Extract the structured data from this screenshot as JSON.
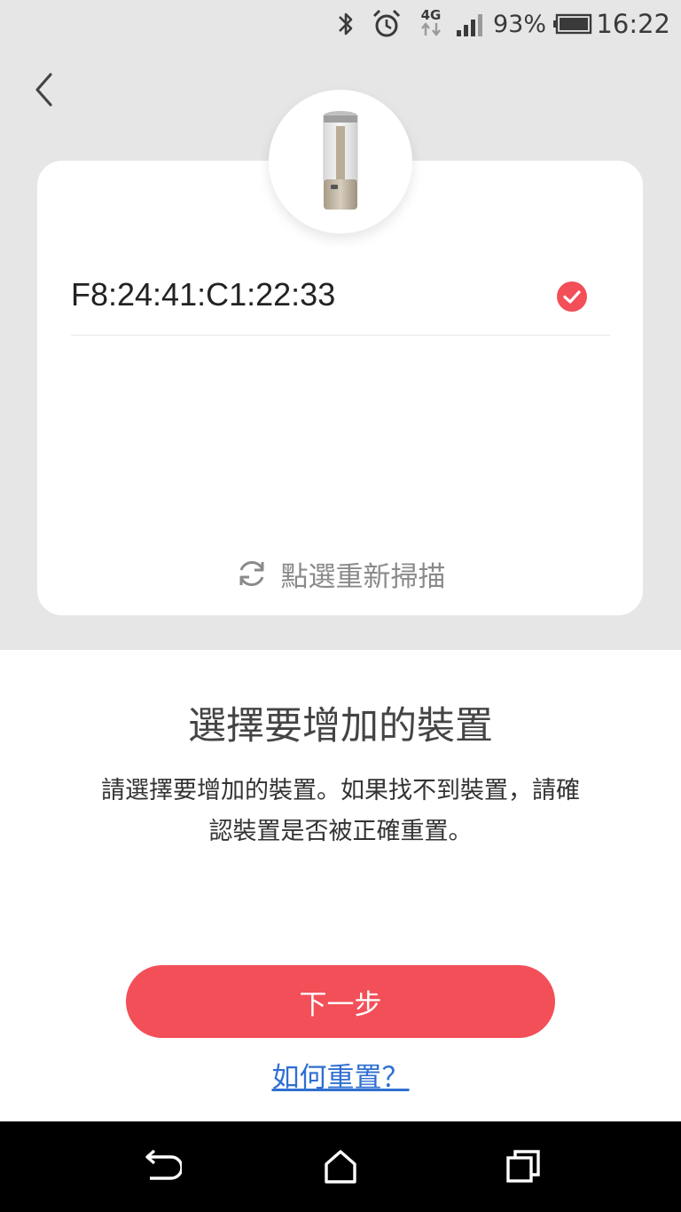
{
  "status_bar": {
    "time": "16:22",
    "battery_percent": "93%",
    "network_type": "4G",
    "icons": [
      "bluetooth-icon",
      "alarm-icon",
      "network-4g-icon",
      "signal-icon",
      "battery-icon"
    ]
  },
  "device": {
    "mac": "F8:24:41:C1:22:33",
    "selected": true,
    "image": "candle-lamp-icon"
  },
  "rescan": {
    "label": "點選重新掃描"
  },
  "title": "選擇要增加的裝置",
  "description_line1": "請選擇要增加的裝置。如果找不到裝置，請確",
  "description_line2": "認裝置是否被正確重置。",
  "next_button": {
    "label": "下一步"
  },
  "help_link": {
    "label": "如何重置？"
  },
  "colors": {
    "accent": "#f24f58",
    "link": "#2f6fd1",
    "background_top": "#e6e6e6"
  },
  "nav_bar": {
    "icons": [
      "back-nav-icon",
      "home-nav-icon",
      "recents-nav-icon"
    ]
  }
}
